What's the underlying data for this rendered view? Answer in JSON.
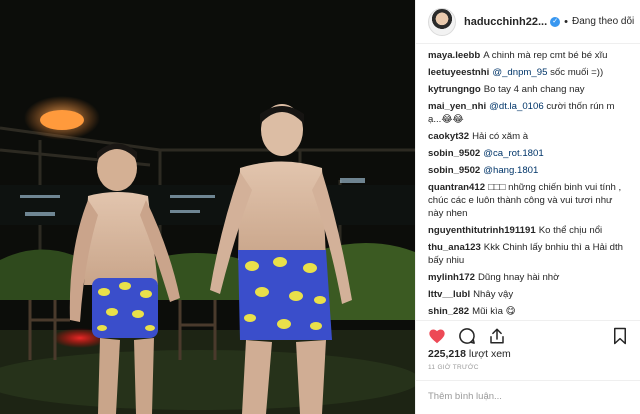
{
  "post": {
    "username": "haducchinh22...",
    "verified_icon": "verified-badge-icon",
    "separator": "•",
    "follow_label": "Đang theo dõi"
  },
  "comments": [
    {
      "user": "maya.leebb",
      "mention": "",
      "text": "A chinh mà rep cmt bé bé xĩu"
    },
    {
      "user": "leetuyeestnhi",
      "mention": "@_dnpm_95",
      "text": "sốc muối =))"
    },
    {
      "user": "kytrungngo",
      "mention": "",
      "text": "Bo tay 4 anh chang nay"
    },
    {
      "user": "mai_yen_nhi",
      "mention": "@dt.la_0106",
      "text": "cười thốn rún m ạ...😂😂"
    },
    {
      "user": "caokyt32",
      "mention": "",
      "text": "Hải có xăm à"
    },
    {
      "user": "sobin_9502",
      "mention": "@ca_rot.1801",
      "text": ""
    },
    {
      "user": "sobin_9502",
      "mention": "@hang.1801",
      "text": ""
    },
    {
      "user": "quantran412",
      "mention": "",
      "text": "□□□ những chiến binh vui tính , chúc các e luôn thành công và vui tươi như này nhen"
    },
    {
      "user": "nguyenthitutrinh191191",
      "mention": "",
      "text": "Ko thể chịu nổi"
    },
    {
      "user": "thu_ana123",
      "mention": "",
      "text": "Kkk Chinh lấy bnhiu thì a Hải dth bấy nhiu"
    },
    {
      "user": "mylinh172",
      "mention": "",
      "text": "Dũng hnay hài nhờ"
    },
    {
      "user": "lttv__lubl",
      "mention": "",
      "text": "Nhây vậy"
    },
    {
      "user": "shin_282",
      "mention": "",
      "text": "Mũi kìa 😋"
    }
  ],
  "actions": {
    "like_icon": "heart-icon",
    "comment_icon": "comment-bubble-icon",
    "share_icon": "share-icon",
    "save_icon": "bookmark-icon",
    "like_color": "#ed4956"
  },
  "stats": {
    "views_count": "225,218",
    "views_label": "lượt xem",
    "time_ago": "11 GIỜ TRƯỚC"
  },
  "comment_box": {
    "placeholder": "Thêm bình luận..."
  }
}
